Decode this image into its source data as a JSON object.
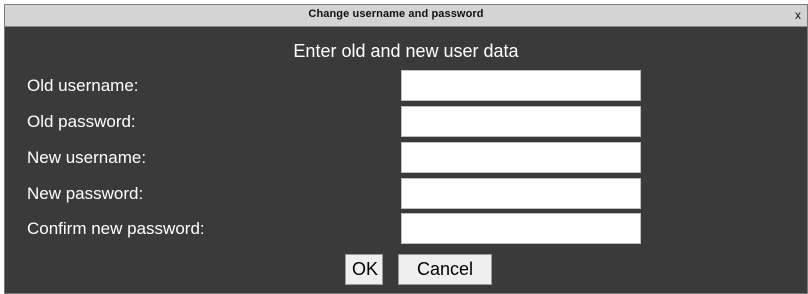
{
  "dialog": {
    "title": "Change username and password",
    "close_label": "x",
    "heading": "Enter old and new user data"
  },
  "fields": [
    {
      "label": "Old username:",
      "value": "",
      "placeholder": ""
    },
    {
      "label": "Old password:",
      "value": "",
      "placeholder": ""
    },
    {
      "label": "New username:",
      "value": "",
      "placeholder": ""
    },
    {
      "label": "New password:",
      "value": "",
      "placeholder": ""
    },
    {
      "label": "Confirm new password:",
      "value": "",
      "placeholder": ""
    }
  ],
  "buttons": {
    "ok_label": "OK",
    "cancel_label": "Cancel"
  }
}
